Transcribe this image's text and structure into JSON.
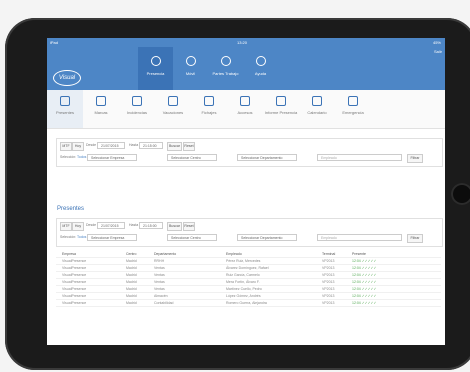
{
  "status": {
    "carrier": "iPad",
    "time": "13:20",
    "battery": "45%"
  },
  "app": {
    "logo": "Visual",
    "corner": "Salir"
  },
  "topnav": [
    {
      "label": "Presencia",
      "icon": "clock-icon",
      "active": true
    },
    {
      "label": "Móvil",
      "icon": "walk-icon",
      "active": false
    },
    {
      "label": "Partes Trabajo",
      "icon": "person-icon",
      "active": false
    },
    {
      "label": "Ayuda",
      "icon": "help-icon",
      "active": false
    }
  ],
  "iconbar": [
    {
      "label": "Presentes",
      "icon": "check-icon",
      "active": true
    },
    {
      "label": "Marcas",
      "icon": "bell-icon",
      "active": false
    },
    {
      "label": "Incidencias",
      "icon": "exclamation-icon",
      "active": false
    },
    {
      "label": "Vacaciones",
      "icon": "plane-icon",
      "active": false
    },
    {
      "label": "Fichajes",
      "icon": "target-icon",
      "active": false
    },
    {
      "label": "Accesos",
      "icon": "arrows-icon",
      "active": false
    },
    {
      "label": "Informe Presencia",
      "icon": "bar-chart-icon",
      "active": false
    },
    {
      "label": "Calendario",
      "icon": "calendar-icon",
      "active": false
    },
    {
      "label": "Emergencia",
      "icon": "link-icon",
      "active": false
    }
  ],
  "filters": {
    "btn_a": "MTF",
    "btn_b": "Hoy",
    "desde_label": "Desde",
    "desde": "21/07/2015",
    "hasta_label": "Hasta",
    "hasta": "21:15:00",
    "buscar": "Buscar",
    "reset": "Reset",
    "seleccion_label": "Selección:",
    "seleccion_value": "Todos",
    "sel_empresa": "Seleccionar Empresa",
    "sel_centro": "Seleccionar Centro",
    "sel_depto": "Seleccionar Departamento",
    "empleado_ph": "Empleado",
    "filtrar": "Filtrar"
  },
  "section_title": "Presentes",
  "table": {
    "headers": [
      "Empresa",
      "Centro",
      "Departamento",
      "Empleado",
      "Terminal",
      "Presente"
    ],
    "rows": [
      [
        "VisualPresence",
        "Madrid",
        "RRHH",
        "Pérez Ruiz, Mercedes",
        "VP2013",
        "12:04 ✓✓✓✓✓"
      ],
      [
        "VisualPresence",
        "Madrid",
        "Ventas",
        "Álvarez Domínguez, Rafael",
        "VP2013",
        "12:04 ✓✓✓✓✓"
      ],
      [
        "VisualPresence",
        "Madrid",
        "Ventas",
        "Ruiz García, Carmelo",
        "VP2013",
        "12:04 ✓✓✓✓✓"
      ],
      [
        "VisualPresence",
        "Madrid",
        "Ventas",
        "Mera Fortín, Álvaro F.",
        "VP2013",
        "12:04 ✓✓✓✓✓"
      ],
      [
        "VisualPresence",
        "Madrid",
        "Ventas",
        "Martínez Cuello, Pedro",
        "VP2013",
        "12:04 ✓✓✓✓✓"
      ],
      [
        "VisualPresence",
        "Madrid",
        "Almacén",
        "López Gómez, Andrés",
        "VP2013",
        "12:04 ✓✓✓✓✓"
      ],
      [
        "VisualPresence",
        "Madrid",
        "Contabilidad",
        "Romero Guerra, Alejandra",
        "VP2013",
        "12:04 ✓✓✓✓✓"
      ]
    ]
  },
  "colors": {
    "accent": "#4d86c6",
    "active": "#3b73b6",
    "ok": "#55aa55"
  }
}
